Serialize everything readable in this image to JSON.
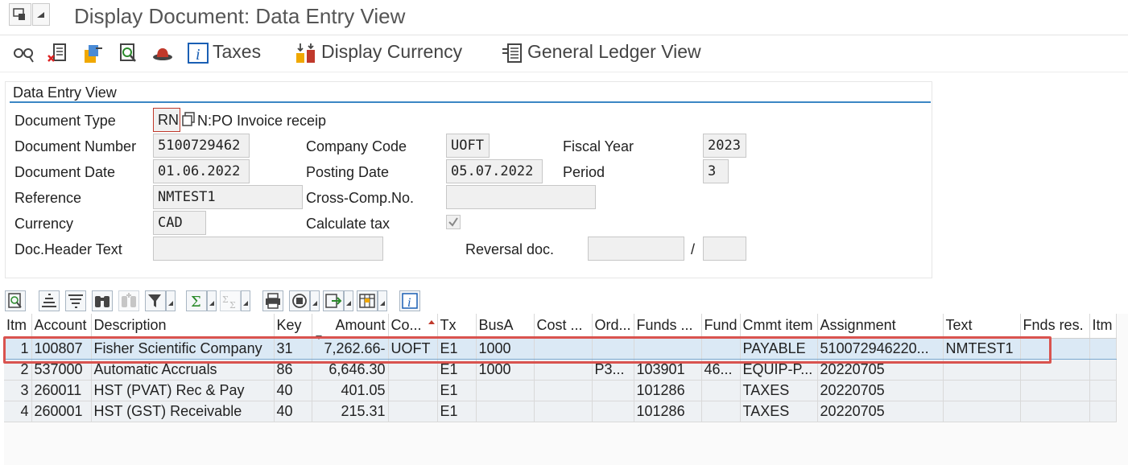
{
  "window": {
    "title": "Display Document: Data Entry View"
  },
  "toolbar": {
    "taxes_label": "Taxes",
    "display_currency_label": "Display Currency",
    "gl_view_label": "General Ledger View"
  },
  "header_panel": {
    "title": "Data Entry View",
    "doc_type_label": "Document Type",
    "doc_type_value": "RN",
    "doc_type_text": "N:PO Invoice receip",
    "doc_number_label": "Document Number",
    "doc_number_value": "5100729462",
    "company_code_label": "Company Code",
    "company_code_value": "UOFT",
    "fiscal_year_label": "Fiscal Year",
    "fiscal_year_value": "2023",
    "doc_date_label": "Document Date",
    "doc_date_value": "01.06.2022",
    "posting_date_label": "Posting Date",
    "posting_date_value": "05.07.2022",
    "period_label": "Period",
    "period_value": "3",
    "reference_label": "Reference",
    "reference_value": "NMTEST1",
    "cross_comp_label": "Cross-Comp.No.",
    "cross_comp_value": "",
    "currency_label": "Currency",
    "currency_value": "CAD",
    "calc_tax_label": "Calculate tax",
    "calc_tax_checked": true,
    "doc_header_text_label": "Doc.Header Text",
    "doc_header_text_value": "",
    "reversal_doc_label": "Reversal doc.",
    "reversal_doc_value": "",
    "reversal_sep": "/",
    "reversal_year_value": ""
  },
  "grid": {
    "columns": [
      "Itm",
      "Account",
      "Description",
      "Key",
      "Amount",
      "Co...",
      "Tx",
      "BusA",
      "Cost ...",
      "Ord...",
      "Funds ...",
      "Fund",
      "Cmmt item",
      "Assignment",
      "Text",
      "Fnds res.",
      "Itm"
    ],
    "rows": [
      [
        "1",
        "100807",
        "Fisher Scientific Company",
        "31",
        "7,262.66-",
        "UOFT",
        "E1",
        "1000",
        "",
        "",
        "",
        "",
        "PAYABLE",
        "510072946220...",
        "NMTEST1",
        "",
        ""
      ],
      [
        "2",
        "537000",
        "Automatic Accruals",
        "86",
        "6,646.30",
        "",
        "E1",
        "1000",
        "",
        "P3...",
        "103901",
        "46...",
        "EQUIP-P...",
        "20220705",
        "",
        "",
        ""
      ],
      [
        "3",
        "260011",
        "HST (PVAT) Rec & Pay",
        "40",
        "401.05",
        "",
        "E1",
        "",
        "",
        "",
        "101286",
        "",
        "TAXES",
        "20220705",
        "",
        "",
        ""
      ],
      [
        "4",
        "260001",
        "HST (GST) Receivable",
        "40",
        "215.31",
        "",
        "E1",
        "",
        "",
        "",
        "101286",
        "",
        "TAXES",
        "20220705",
        "",
        "",
        ""
      ]
    ],
    "selected_row": 0
  },
  "colors": {
    "accent_line": "#3b86c4",
    "highlight": "#d9534f",
    "selected_row": "#dbe9f5"
  }
}
